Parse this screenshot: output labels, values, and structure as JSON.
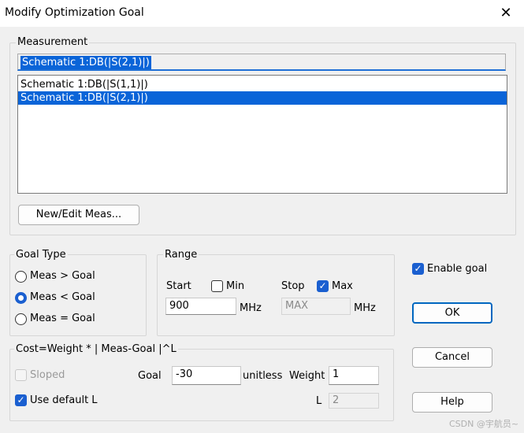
{
  "window": {
    "title": "Modify Optimization Goal",
    "close_glyph": "✕"
  },
  "measurement": {
    "group_label": "Measurement",
    "selected": "Schematic 1:DB(|S(2,1)|)",
    "items": [
      "Schematic 1:DB(|S(1,1)|)",
      "Schematic 1:DB(|S(2,1)|)"
    ],
    "new_edit_label": "New/Edit Meas..."
  },
  "goal_type": {
    "group_label": "Goal Type",
    "options": [
      "Meas > Goal",
      "Meas < Goal",
      "Meas = Goal"
    ],
    "selected_index": 1
  },
  "range": {
    "group_label": "Range",
    "start_label": "Start",
    "min_label": "Min",
    "start_value": "900",
    "start_unit": "MHz",
    "stop_label": "Stop",
    "max_label": "Max",
    "stop_placeholder": "MAX",
    "stop_unit": "MHz",
    "min_checked": false,
    "max_checked": true
  },
  "cost": {
    "group_label": "Cost=Weight * | Meas-Goal |^L",
    "sloped_label": "Sloped",
    "use_default_l_label": "Use default L",
    "goal_label": "Goal",
    "goal_value": "-30",
    "goal_unit": "unitless",
    "weight_label": "Weight",
    "weight_value": "1",
    "l_label": "L",
    "l_value": "2"
  },
  "actions": {
    "enable_goal_label": "Enable goal",
    "ok_label": "OK",
    "cancel_label": "Cancel",
    "help_label": "Help"
  },
  "watermark": "CSDN @宇航员~",
  "colors": {
    "accent": "#1a5fd0",
    "selection": "#0a64d8"
  }
}
